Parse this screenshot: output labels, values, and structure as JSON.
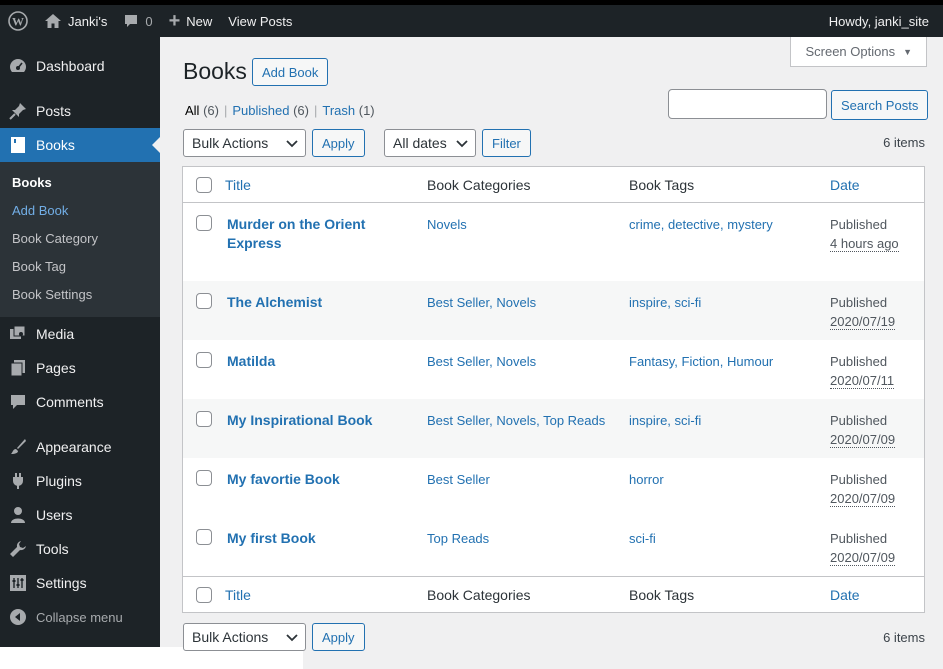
{
  "adminbar": {
    "site": "Janki's",
    "comments": "0",
    "new": "New",
    "view_posts": "View Posts",
    "howdy": "Howdy, janki_site"
  },
  "sidebar": {
    "dashboard": "Dashboard",
    "posts": "Posts",
    "books": "Books",
    "submenu": [
      "Books",
      "Add Book",
      "Book Category",
      "Book Tag",
      "Book Settings"
    ],
    "media": "Media",
    "pages": "Pages",
    "comments": "Comments",
    "appearance": "Appearance",
    "plugins": "Plugins",
    "users": "Users",
    "tools": "Tools",
    "settings": "Settings",
    "collapse": "Collapse menu"
  },
  "main": {
    "screen_options": "Screen Options",
    "title": "Books",
    "add_book": "Add Book",
    "views": {
      "all": "All",
      "all_count": "(6)",
      "published": "Published",
      "published_count": "(6)",
      "trash": "Trash",
      "trash_count": "(1)"
    },
    "search_button": "Search Posts",
    "bulk_actions": "Bulk Actions",
    "apply": "Apply",
    "all_dates": "All dates",
    "filter": "Filter",
    "items": "6 items",
    "columns": {
      "title": "Title",
      "categories": "Book Categories",
      "tags": "Book Tags",
      "date": "Date"
    },
    "rows": [
      {
        "title": "Murder on the Orient Express",
        "categories": "Novels",
        "tags": "crime, detective, mystery",
        "status": "Published",
        "when": "4 hours ago"
      },
      {
        "title": "The Alchemist",
        "categories": "Best Seller, Novels",
        "tags": "inspire, sci-fi",
        "status": "Published",
        "when": "2020/07/19"
      },
      {
        "title": "Matilda",
        "categories": "Best Seller, Novels",
        "tags": "Fantasy, Fiction, Humour",
        "status": "Published",
        "when": "2020/07/11"
      },
      {
        "title": "My Inspirational Book",
        "categories": "Best Seller, Novels, Top Reads",
        "tags": "inspire, sci-fi",
        "status": "Published",
        "when": "2020/07/09"
      },
      {
        "title": "My favortie Book",
        "categories": "Best Seller",
        "tags": "horror",
        "status": "Published",
        "when": "2020/07/09"
      },
      {
        "title": "My first Book",
        "categories": "Top Reads",
        "tags": "sci-fi",
        "status": "Published",
        "when": "2020/07/09"
      }
    ]
  }
}
